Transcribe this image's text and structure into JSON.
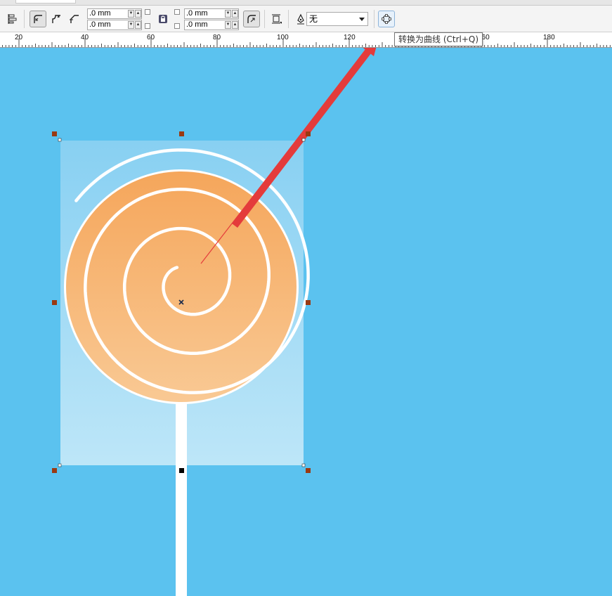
{
  "toolbar": {
    "x_offset": ".0 mm",
    "y_offset": ".0 mm",
    "x_offset2": ".0 mm",
    "y_offset2": ".0 mm",
    "outline_style": "无"
  },
  "ruler": {
    "labels": [
      "20",
      "40",
      "60",
      "80",
      "100",
      "120",
      "160",
      "180"
    ]
  },
  "tooltip": {
    "text": "转换为曲线 (Ctrl+Q)"
  },
  "colors": {
    "canvas": "#5bc2ef",
    "arrow": "#e43b3b",
    "candy_top": "#f5a65b",
    "candy_bottom": "#f9c994",
    "handle": "#9a3a12"
  }
}
